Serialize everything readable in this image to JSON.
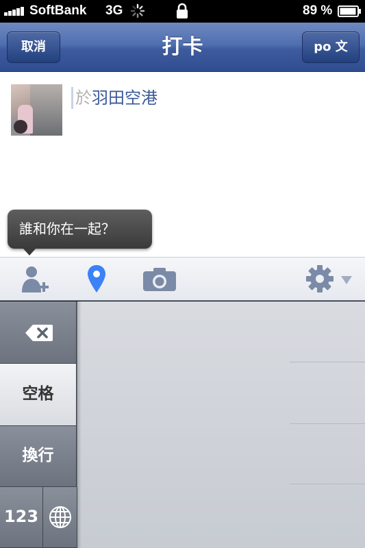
{
  "status_bar": {
    "carrier": "SoftBank",
    "network": "3G",
    "battery_percent": "89 %",
    "icons": [
      "signal-icon",
      "activity-spinner-icon",
      "lock-icon",
      "battery-icon"
    ]
  },
  "nav": {
    "title": "打卡",
    "cancel_label": "取消",
    "post_label": "po 文"
  },
  "compose": {
    "location_prefix": "於",
    "location_name": "羽田空港"
  },
  "tooltip": {
    "text": "誰和你在一起？"
  },
  "toolbar": {
    "icons": [
      "add-friend-icon",
      "location-pin-icon",
      "camera-icon",
      "gear-icon",
      "dropdown-arrow-icon"
    ],
    "active_color": "#3b82f6",
    "inactive_color": "#7b8aa6"
  },
  "keyboard": {
    "space_label": "空格",
    "enter_label": "換行",
    "numbers_label": "123",
    "icons": [
      "delete-icon",
      "globe-icon"
    ]
  }
}
